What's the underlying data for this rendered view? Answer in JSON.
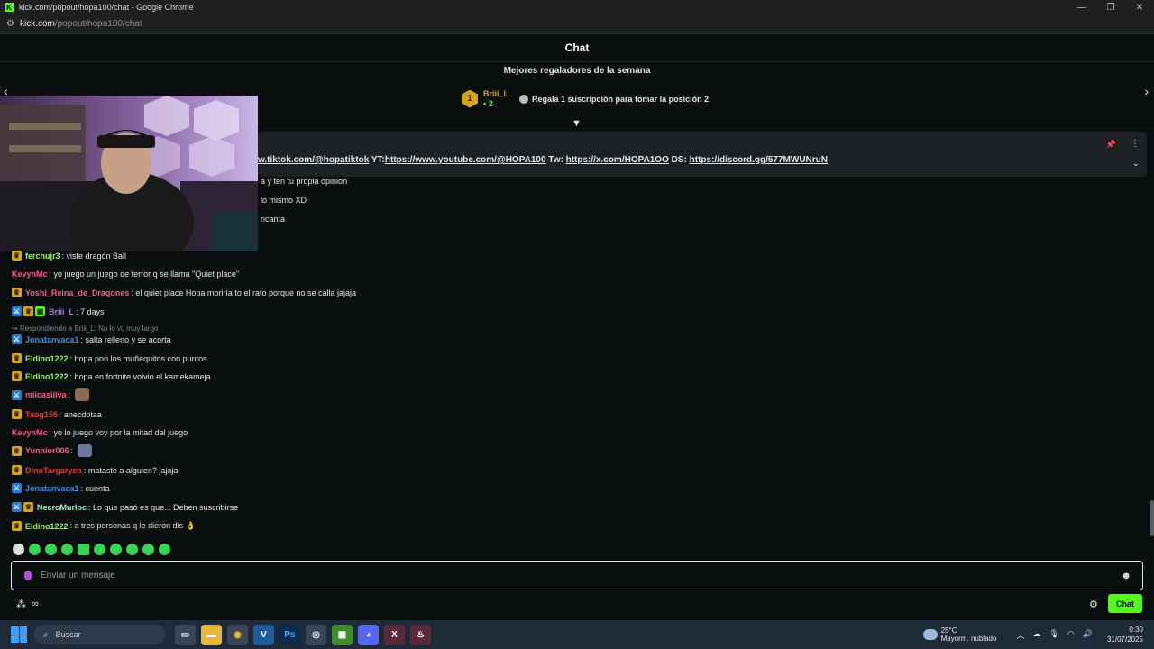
{
  "window": {
    "title": "kick.com/popout/hopa100/chat - Google Chrome"
  },
  "address": {
    "host": "kick.com",
    "path": "/popout/hopa100/chat"
  },
  "chat_header": {
    "title": "Chat"
  },
  "gifters": {
    "title": "Mejores regaladores de la semana",
    "rank": "1",
    "top_name": "Briii_L",
    "top_count": "2",
    "cta": "Regala 1 suscripción para tomar la posición 2"
  },
  "pinned": {
    "tiktok_prefix": "",
    "tiktok_link": "w.tiktok.com/@hopatiktok",
    "yt_prefix": " YT:",
    "yt_link": "https://www.youtube.com/@HOPA100",
    "tw_prefix": " Tw: ",
    "tw_link": "https://x.com/HOPA1OO",
    "ds_prefix": " DS: ",
    "ds_link": "https://discord.gg/577MWUNruN"
  },
  "partial_lines": [
    "a y ten tu propia opinion",
    "lo mismo XD",
    "ncanta"
  ],
  "messages": [
    {
      "user": "ferchujr3",
      "color": "#9bf268",
      "text": ": viste dragón Ball"
    },
    {
      "user": "KevynMc",
      "color": "#f25f8a",
      "text": ": yo juego un juego de terror q se llama \"Quiet place\""
    },
    {
      "user": "Yoshi_Reina_de_Dragones",
      "color": "#f25f8a",
      "text": ": el quiet place Hopa moriría to el rato porque no se calla jajaja"
    },
    {
      "user": "Briii_L",
      "color": "#b76cf0",
      "text": ": 7 days"
    },
    {
      "reply": "Respondiendo a Briii_L: No lo vi, muy largo",
      "user": "Jonatanvaca1",
      "color": "#3b8fe8",
      "text": ": salta relleno y se acorta"
    },
    {
      "user": "Eldino1222",
      "color": "#9bf268",
      "text": ": hopa pon los muñequitos con puntos"
    },
    {
      "user": "Eldino1222",
      "color": "#9bf268",
      "text": ": hopa en fortnite volvio el kamekameja"
    },
    {
      "user": "miicasiilva",
      "color": "#f25f8a",
      "text": ":"
    },
    {
      "user": "Taog155",
      "color": "#e23b3b",
      "text": ": anecdotaa"
    },
    {
      "user": "KevynMc",
      "color": "#f25f8a",
      "text": ": yo lo juego voy por la mitad del juego"
    },
    {
      "user": "Yunnior006",
      "color": "#f25f8a",
      "text": ":"
    },
    {
      "user": "DinoTargaryen",
      "color": "#e23b3b",
      "text": ": mataste a alguien? jajaja"
    },
    {
      "user": "Jonatanvaca1",
      "color": "#3b8fe8",
      "text": ": cuenta"
    },
    {
      "user": "NecroMurloc",
      "color": "#9bf2c8",
      "text": ": Lo que pasó es que... Deben suscribirse"
    },
    {
      "user": "Eldino1222",
      "color": "#9bf268",
      "text": ": a tres personas q le dieron dis 👌"
    }
  ],
  "input": {
    "placeholder": "Enviar un mensaje"
  },
  "chat_button": {
    "label": "Chat"
  },
  "taskbar": {
    "search": "Buscar",
    "temp": "25°C",
    "weather": "Mayorm. nublado",
    "time": "0:30",
    "date": "31/07/2025"
  }
}
